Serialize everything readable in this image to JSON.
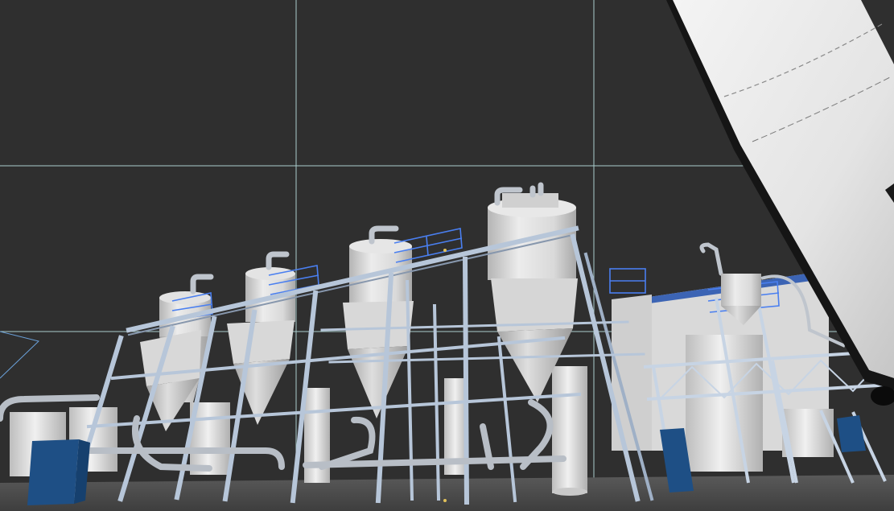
{
  "viewport": {
    "background": "#2f2f2f",
    "grid_color": "#b9dede",
    "ground_color": "#4b4b4b",
    "label": ""
  },
  "palette": {
    "vessel_light": "#e9e9e9",
    "vessel_mid": "#cfcfcf",
    "vessel_shadow": "#a9a9a9",
    "frame_steel": "#b7c6d9",
    "frame_edge": "#8797ad",
    "railing_blue": "#4a7ff0",
    "panel_blue": "#1e4f85",
    "building_wall": "#d9d9d9",
    "building_roof": "#3c64b4",
    "silo_white": "#f0f0f0",
    "silo_edge": "#1a1a1a"
  },
  "scene": {
    "evaporator_count": 4,
    "tank_count": 8,
    "control_panel_count": 3
  }
}
